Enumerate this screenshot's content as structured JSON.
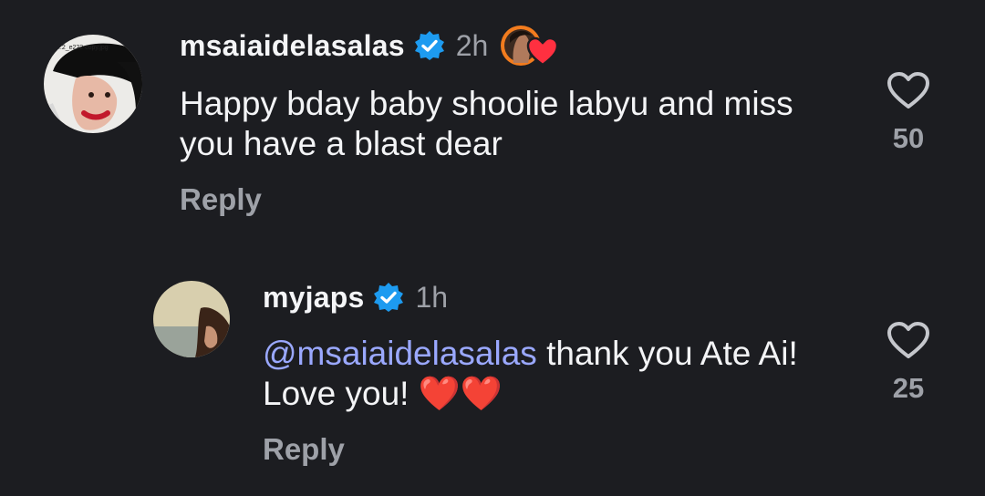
{
  "comments": [
    {
      "username": "msaiaidelasalas",
      "time": "2h",
      "text": "Happy bday baby shoolie labyu and miss you have a blast dear",
      "reply_label": "Reply",
      "like_count": "50",
      "avatar_label": "...2_e222 copy.jpg",
      "verified": true
    },
    {
      "username": "myjaps",
      "time": "1h",
      "mention": "@msaiaidelasalas",
      "text": " thank you Ate Ai! Love you! ❤️❤️",
      "reply_label": "Reply",
      "like_count": "25",
      "verified": true
    }
  ],
  "colors": {
    "background": "#1c1d21",
    "verified_badge": "#1d9bf0",
    "mention": "#9aa8ff",
    "muted": "#9ea1a8",
    "heart": "#ff3040"
  },
  "icons": {
    "verified": "verified-badge-icon",
    "like": "heart-outline-icon",
    "liked_by_creator": "creator-heart-icon"
  }
}
